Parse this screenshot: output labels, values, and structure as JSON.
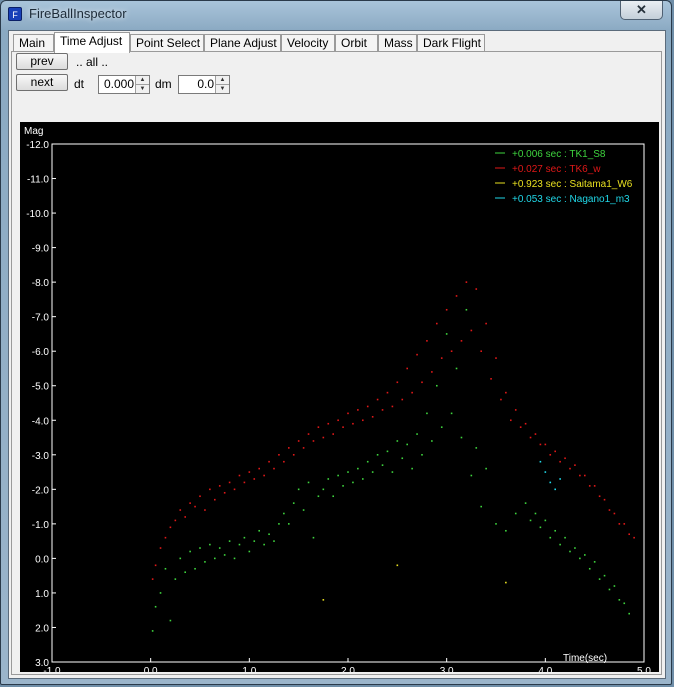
{
  "window": {
    "title": "FireBallInspector",
    "close_glyph": "✕",
    "icon": "app-icon"
  },
  "tabs": [
    {
      "label": "Main",
      "active": false
    },
    {
      "label": "Time Adjust",
      "active": true
    },
    {
      "label": "Point Select",
      "active": false
    },
    {
      "label": "Plane Adjust",
      "active": false
    },
    {
      "label": "Velocity",
      "active": false
    },
    {
      "label": "Orbit",
      "active": false
    },
    {
      "label": "Mass",
      "active": false
    },
    {
      "label": "Dark Flight",
      "active": false
    }
  ],
  "controls": {
    "prev_label": "prev",
    "all_label": ".. all ..",
    "next_label": "next",
    "dt_label": "dt",
    "dt_value": "0.000",
    "dm_label": "dm",
    "dm_value": "0.0"
  },
  "chart_data": {
    "type": "scatter",
    "ylabel": "Mag",
    "xlabel": "Time(sec)",
    "xlim": [
      -1.0,
      5.0
    ],
    "ylim": [
      -12.0,
      3.0
    ],
    "y_inverted": false,
    "xticks": [
      "-1.0",
      "0.0",
      "1.0",
      "2.0",
      "3.0",
      "4.0",
      "5.0"
    ],
    "xtick_values": [
      -1,
      0,
      1,
      2,
      3,
      4,
      5
    ],
    "yticks": [
      "-12.0",
      "-11.0",
      "-10.0",
      "-9.0",
      "-8.0",
      "-7.0",
      "-6.0",
      "-5.0",
      "-4.0",
      "-3.0",
      "-2.0",
      "-1.0",
      "0.0",
      "1.0",
      "2.0",
      "3.0"
    ],
    "ytick_values": [
      -12,
      -11,
      -10,
      -9,
      -8,
      -7,
      -6,
      -5,
      -4,
      -3,
      -2,
      -1,
      0,
      1,
      2,
      3
    ],
    "legend_position": "top-right",
    "series": [
      {
        "name": "+0.006 sec : TK1_S8",
        "color": "#3ed43e",
        "points": [
          [
            0.02,
            2.1
          ],
          [
            0.05,
            1.4
          ],
          [
            0.1,
            1.0
          ],
          [
            0.15,
            0.3
          ],
          [
            0.2,
            1.8
          ],
          [
            0.25,
            0.6
          ],
          [
            0.3,
            0.0
          ],
          [
            0.35,
            0.4
          ],
          [
            0.4,
            -0.2
          ],
          [
            0.45,
            0.3
          ],
          [
            0.5,
            -0.3
          ],
          [
            0.55,
            0.1
          ],
          [
            0.6,
            -0.4
          ],
          [
            0.65,
            0.0
          ],
          [
            0.7,
            -0.3
          ],
          [
            0.75,
            -0.1
          ],
          [
            0.8,
            -0.5
          ],
          [
            0.85,
            0.0
          ],
          [
            0.9,
            -0.4
          ],
          [
            0.95,
            -0.6
          ],
          [
            1.0,
            -0.2
          ],
          [
            1.05,
            -0.5
          ],
          [
            1.1,
            -0.8
          ],
          [
            1.15,
            -0.4
          ],
          [
            1.2,
            -0.7
          ],
          [
            1.25,
            -0.5
          ],
          [
            1.3,
            -1.0
          ],
          [
            1.35,
            -1.3
          ],
          [
            1.4,
            -1.0
          ],
          [
            1.45,
            -1.6
          ],
          [
            1.5,
            -2.0
          ],
          [
            1.55,
            -1.4
          ],
          [
            1.6,
            -2.2
          ],
          [
            1.65,
            -0.6
          ],
          [
            1.7,
            -1.8
          ],
          [
            1.75,
            -2.0
          ],
          [
            1.8,
            -2.3
          ],
          [
            1.85,
            -1.8
          ],
          [
            1.9,
            -2.4
          ],
          [
            1.95,
            -2.1
          ],
          [
            2.0,
            -2.5
          ],
          [
            2.05,
            -2.2
          ],
          [
            2.1,
            -2.6
          ],
          [
            2.15,
            -2.3
          ],
          [
            2.2,
            -2.8
          ],
          [
            2.25,
            -2.5
          ],
          [
            2.3,
            -3.0
          ],
          [
            2.35,
            -2.7
          ],
          [
            2.4,
            -3.1
          ],
          [
            2.45,
            -2.5
          ],
          [
            2.5,
            -3.4
          ],
          [
            2.55,
            -2.9
          ],
          [
            2.6,
            -3.3
          ],
          [
            2.65,
            -2.6
          ],
          [
            2.7,
            -3.6
          ],
          [
            2.75,
            -3.0
          ],
          [
            2.8,
            -4.2
          ],
          [
            2.85,
            -3.4
          ],
          [
            2.9,
            -5.0
          ],
          [
            2.95,
            -3.8
          ],
          [
            3.0,
            -6.5
          ],
          [
            3.05,
            -4.2
          ],
          [
            3.1,
            -5.5
          ],
          [
            3.15,
            -3.5
          ],
          [
            3.2,
            -7.2
          ],
          [
            3.25,
            -2.4
          ],
          [
            3.3,
            -3.2
          ],
          [
            3.35,
            -1.5
          ],
          [
            3.4,
            -2.6
          ],
          [
            3.5,
            -1.0
          ],
          [
            3.6,
            -0.8
          ],
          [
            3.7,
            -1.3
          ],
          [
            3.8,
            -1.6
          ],
          [
            3.85,
            -1.1
          ],
          [
            3.9,
            -1.3
          ],
          [
            3.95,
            -0.9
          ],
          [
            4.0,
            -1.1
          ],
          [
            4.05,
            -0.6
          ],
          [
            4.1,
            -0.8
          ],
          [
            4.15,
            -0.4
          ],
          [
            4.2,
            -0.6
          ],
          [
            4.25,
            -0.2
          ],
          [
            4.3,
            -0.3
          ],
          [
            4.35,
            0.0
          ],
          [
            4.4,
            -0.1
          ],
          [
            4.45,
            0.3
          ],
          [
            4.5,
            0.1
          ],
          [
            4.55,
            0.6
          ],
          [
            4.6,
            0.5
          ],
          [
            4.65,
            0.9
          ],
          [
            4.7,
            0.8
          ],
          [
            4.75,
            1.2
          ],
          [
            4.8,
            1.3
          ],
          [
            4.85,
            1.6
          ]
        ]
      },
      {
        "name": "+0.027 sec : TK6_w",
        "color": "#e01818",
        "points": [
          [
            0.02,
            0.6
          ],
          [
            0.05,
            0.2
          ],
          [
            0.1,
            -0.3
          ],
          [
            0.15,
            -0.6
          ],
          [
            0.2,
            -0.9
          ],
          [
            0.25,
            -1.1
          ],
          [
            0.3,
            -1.4
          ],
          [
            0.35,
            -1.2
          ],
          [
            0.4,
            -1.6
          ],
          [
            0.45,
            -1.5
          ],
          [
            0.5,
            -1.8
          ],
          [
            0.55,
            -1.4
          ],
          [
            0.6,
            -2.0
          ],
          [
            0.65,
            -1.7
          ],
          [
            0.7,
            -2.1
          ],
          [
            0.75,
            -1.9
          ],
          [
            0.8,
            -2.2
          ],
          [
            0.85,
            -2.0
          ],
          [
            0.9,
            -2.4
          ],
          [
            0.95,
            -2.2
          ],
          [
            1.0,
            -2.5
          ],
          [
            1.05,
            -2.3
          ],
          [
            1.1,
            -2.6
          ],
          [
            1.15,
            -2.4
          ],
          [
            1.2,
            -2.8
          ],
          [
            1.25,
            -2.6
          ],
          [
            1.3,
            -3.0
          ],
          [
            1.35,
            -2.8
          ],
          [
            1.4,
            -3.2
          ],
          [
            1.45,
            -3.0
          ],
          [
            1.5,
            -3.4
          ],
          [
            1.55,
            -3.2
          ],
          [
            1.6,
            -3.6
          ],
          [
            1.65,
            -3.4
          ],
          [
            1.7,
            -3.8
          ],
          [
            1.75,
            -3.5
          ],
          [
            1.8,
            -3.9
          ],
          [
            1.85,
            -3.6
          ],
          [
            1.9,
            -4.0
          ],
          [
            1.95,
            -3.8
          ],
          [
            2.0,
            -4.2
          ],
          [
            2.05,
            -3.9
          ],
          [
            2.1,
            -4.3
          ],
          [
            2.15,
            -4.0
          ],
          [
            2.2,
            -4.4
          ],
          [
            2.25,
            -4.1
          ],
          [
            2.3,
            -4.6
          ],
          [
            2.35,
            -4.3
          ],
          [
            2.4,
            -4.8
          ],
          [
            2.45,
            -4.4
          ],
          [
            2.5,
            -5.1
          ],
          [
            2.55,
            -4.6
          ],
          [
            2.6,
            -5.5
          ],
          [
            2.65,
            -4.8
          ],
          [
            2.7,
            -5.9
          ],
          [
            2.75,
            -5.1
          ],
          [
            2.8,
            -6.3
          ],
          [
            2.85,
            -5.4
          ],
          [
            2.9,
            -6.8
          ],
          [
            2.95,
            -5.8
          ],
          [
            3.0,
            -7.2
          ],
          [
            3.05,
            -6.0
          ],
          [
            3.1,
            -7.6
          ],
          [
            3.15,
            -6.3
          ],
          [
            3.2,
            -8.0
          ],
          [
            3.25,
            -6.6
          ],
          [
            3.3,
            -7.8
          ],
          [
            3.35,
            -6.0
          ],
          [
            3.4,
            -6.8
          ],
          [
            3.45,
            -5.2
          ],
          [
            3.5,
            -5.8
          ],
          [
            3.55,
            -4.6
          ],
          [
            3.6,
            -4.8
          ],
          [
            3.65,
            -4.0
          ],
          [
            3.7,
            -4.3
          ],
          [
            3.75,
            -3.8
          ],
          [
            3.8,
            -3.9
          ],
          [
            3.85,
            -3.5
          ],
          [
            3.9,
            -3.6
          ],
          [
            3.95,
            -3.3
          ],
          [
            4.0,
            -3.3
          ],
          [
            4.05,
            -3.0
          ],
          [
            4.1,
            -3.1
          ],
          [
            4.15,
            -2.8
          ],
          [
            4.2,
            -2.9
          ],
          [
            4.25,
            -2.6
          ],
          [
            4.3,
            -2.7
          ],
          [
            4.35,
            -2.4
          ],
          [
            4.4,
            -2.4
          ],
          [
            4.45,
            -2.1
          ],
          [
            4.5,
            -2.1
          ],
          [
            4.55,
            -1.8
          ],
          [
            4.6,
            -1.7
          ],
          [
            4.65,
            -1.4
          ],
          [
            4.7,
            -1.3
          ],
          [
            4.75,
            -1.0
          ],
          [
            4.8,
            -1.0
          ],
          [
            4.85,
            -0.7
          ],
          [
            4.9,
            -0.6
          ]
        ]
      },
      {
        "name": "+0.923 sec : Saitama1_W6",
        "color": "#e8e020",
        "points": [
          [
            1.75,
            1.2
          ],
          [
            2.5,
            0.2
          ],
          [
            3.6,
            0.7
          ]
        ]
      },
      {
        "name": "+0.053 sec : Nagano1_m3",
        "color": "#20d8e8",
        "points": [
          [
            3.95,
            -2.8
          ],
          [
            4.0,
            -2.5
          ],
          [
            4.05,
            -2.2
          ],
          [
            4.1,
            -2.0
          ],
          [
            4.15,
            -2.3
          ]
        ]
      }
    ]
  }
}
